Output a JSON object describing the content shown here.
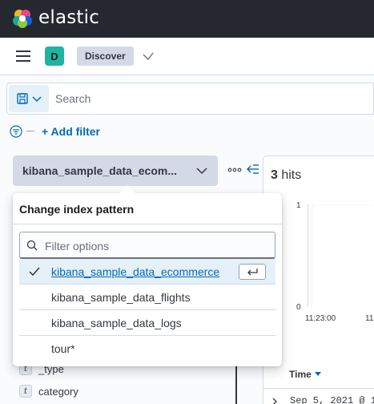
{
  "header": {
    "brand": "elastic"
  },
  "nav": {
    "space_initial": "D",
    "breadcrumb": "Discover"
  },
  "search": {
    "placeholder": "Search"
  },
  "filters": {
    "add_filter_label": "+ Add filter"
  },
  "index_pattern": {
    "selected_label": "kibana_sample_data_ecom..."
  },
  "popover": {
    "title": "Change index pattern",
    "filter_placeholder": "Filter options",
    "options": [
      {
        "label": "kibana_sample_data_ecommerce",
        "selected": true
      },
      {
        "label": "kibana_sample_data_flights",
        "selected": false
      },
      {
        "label": "kibana_sample_data_logs",
        "selected": false
      },
      {
        "label": "tour*",
        "selected": false
      }
    ]
  },
  "sidebar": {
    "fields": [
      {
        "type": "t",
        "name": "_type"
      },
      {
        "type": "t",
        "name": "category"
      }
    ]
  },
  "results": {
    "hits_number": "3",
    "hits_label": " hits",
    "y_tick_top": "1",
    "y_tick_bottom": "0",
    "x_tick_1": "11:23:00",
    "x_tick_2": "11:",
    "time_column": "Time",
    "first_row_time": "Sep 5, 2021 @ 1"
  },
  "colors": {
    "header_bg": "#25282f",
    "accent": "#006bb8",
    "space_avatar": "#1fb4a0",
    "selected_option_bg": "#e6f0f8"
  }
}
